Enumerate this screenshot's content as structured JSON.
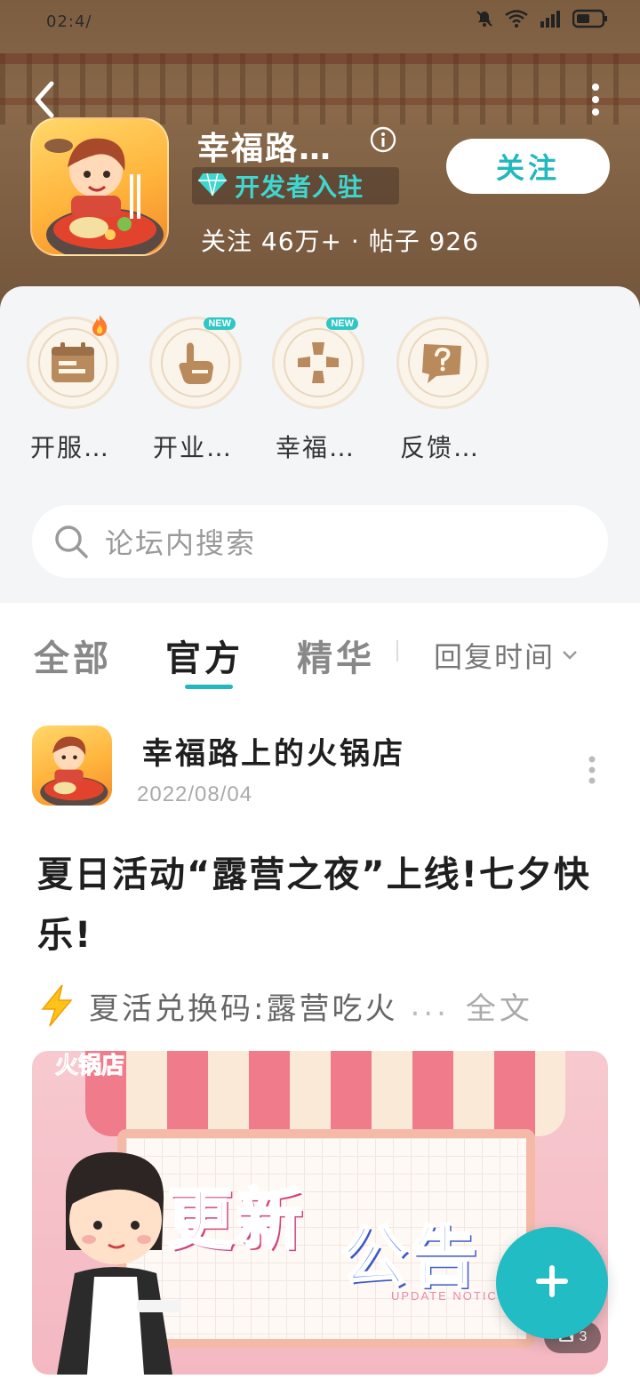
{
  "status_bar": {
    "time": "02:4/"
  },
  "header": {
    "game_name": "幸福路…",
    "developer_badge": "开发者入驻",
    "follow_label": "关注",
    "stats": "关注 46万+ · 帖子 926"
  },
  "shortcuts": [
    {
      "label": "开服…",
      "icon": "calendar-icon",
      "badge": ""
    },
    {
      "label": "开业…",
      "icon": "hand-pointer-icon",
      "badge": "NEW"
    },
    {
      "label": "幸福…",
      "icon": "gamepad-icon",
      "badge": "NEW"
    },
    {
      "label": "反馈…",
      "icon": "question-icon",
      "badge": ""
    }
  ],
  "search": {
    "placeholder": "论坛内搜索"
  },
  "tabs": [
    "全部",
    "官方",
    "精华"
  ],
  "sort": {
    "label": "回复时间"
  },
  "post": {
    "author": "幸福路上的火锅店",
    "date": "2022/08/04",
    "title": "夏日活动“露营之夜”上线!七夕快乐!",
    "excerpt": "夏活兑换码:露营吃火",
    "excerpt_ellipsis": "...",
    "full_text_link": "全文",
    "banner_title_1": "更新",
    "banner_title_2": "公告",
    "banner_subtitle": "UPDATE NOTICE",
    "banner_logo": "火锅店",
    "image_count": "3"
  },
  "colors": {
    "accent": "#22b8bf",
    "header_bg": "#8b6b4e"
  }
}
